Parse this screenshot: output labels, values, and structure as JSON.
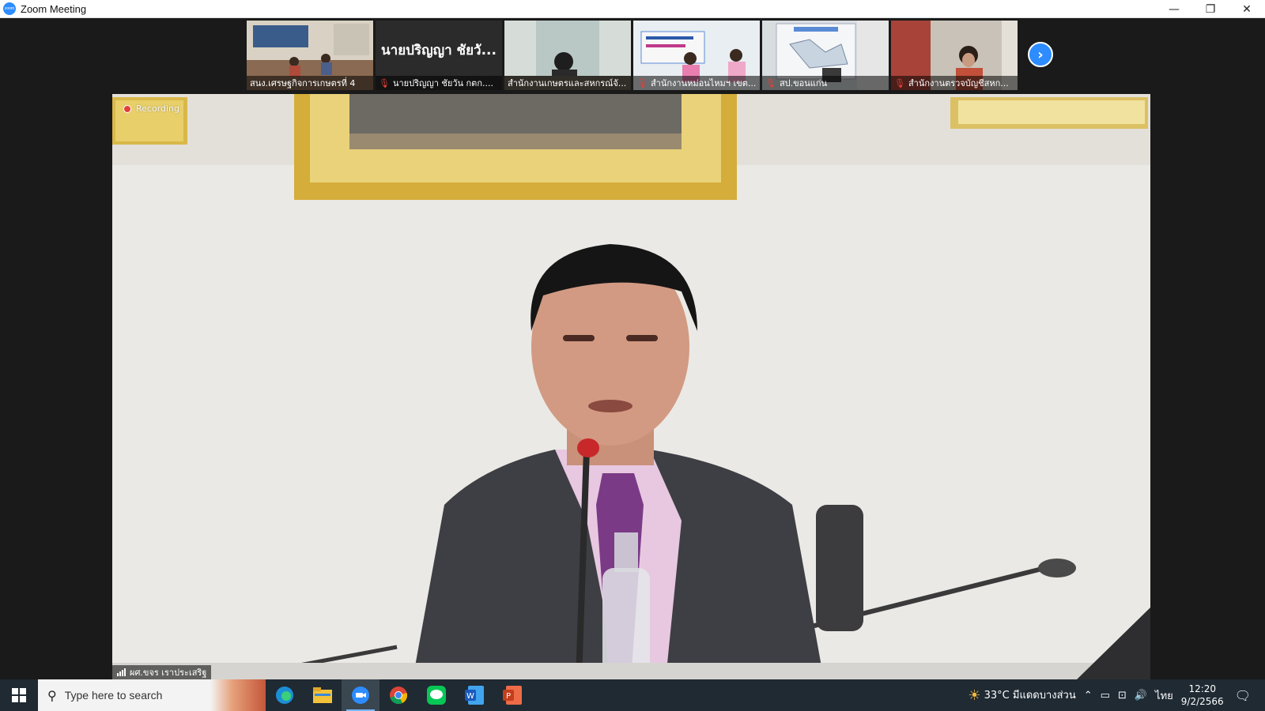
{
  "window": {
    "title": "Zoom Meeting",
    "controls": {
      "minimize": "—",
      "restore": "❐",
      "close": "✕"
    },
    "accent": "#2d8cff"
  },
  "thumbnails": [
    {
      "label": "สนง.เศรษฐกิจการเกษตรที่ 4",
      "muted": false,
      "video": true
    },
    {
      "label": "นายปริญญา ชัยวัน กตก....",
      "muted": true,
      "video": false,
      "name_display": "นายปริญญา ชัยวั..."
    },
    {
      "label": "สำนักงานเกษตรและสหกรณ์จั...",
      "muted": false,
      "video": true
    },
    {
      "label": "สำนักงานหม่อนไหมฯ เขต...",
      "muted": true,
      "video": true
    },
    {
      "label": "สป.ขอนแก่น",
      "muted": true,
      "video": true
    },
    {
      "label": "สำนักงานตรวจบัญชีสหก...",
      "muted": true,
      "video": true
    }
  ],
  "main_video": {
    "recording_label": "Recording",
    "speaker": "ผศ.ขจร เราประเสริฐ"
  },
  "taskbar": {
    "search_placeholder": "Type here to search",
    "apps": [
      "edge-icon",
      "file-explorer-icon",
      "zoom-icon",
      "chrome-icon",
      "line-icon",
      "word-icon",
      "powerpoint-icon"
    ],
    "weather": "33°C  มีแดดบางส่วน",
    "language": "ไทย",
    "time": "12:20",
    "date": "9/2/2566"
  }
}
